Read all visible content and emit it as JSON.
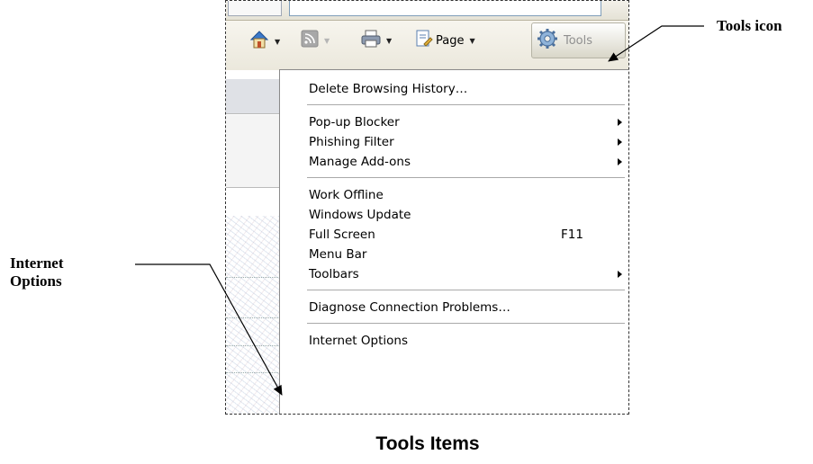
{
  "callouts": {
    "tools_icon": "Tools icon",
    "internet_options": "Internet\nOptions"
  },
  "caption": "Tools Items",
  "toolbar": {
    "icons": [
      "home-icon",
      "feeds-icon",
      "print-icon",
      "page-icon",
      "tools-gear-icon"
    ],
    "page_label": "Page",
    "tools_label": "Tools"
  },
  "tools_menu": {
    "groups": [
      [
        {
          "label": "Delete Browsing History…"
        }
      ],
      [
        {
          "label": "Pop-up Blocker",
          "submenu": true
        },
        {
          "label": "Phishing Filter",
          "submenu": true
        },
        {
          "label": "Manage Add-ons",
          "submenu": true
        }
      ],
      [
        {
          "label": "Work Offline"
        },
        {
          "label": "Windows Update"
        },
        {
          "label": "Full Screen",
          "shortcut": "F11"
        },
        {
          "label": "Menu Bar"
        },
        {
          "label": "Toolbars",
          "submenu": true
        }
      ],
      [
        {
          "label": "Diagnose Connection Problems…"
        }
      ],
      [
        {
          "label": "Internet Options"
        }
      ]
    ]
  },
  "colors": {
    "toolbar_bg": "#ece9dc",
    "menu_border": "#8a8a8a",
    "home_blue": "#3a78c9",
    "feed_gray": "#a8a8a8"
  }
}
